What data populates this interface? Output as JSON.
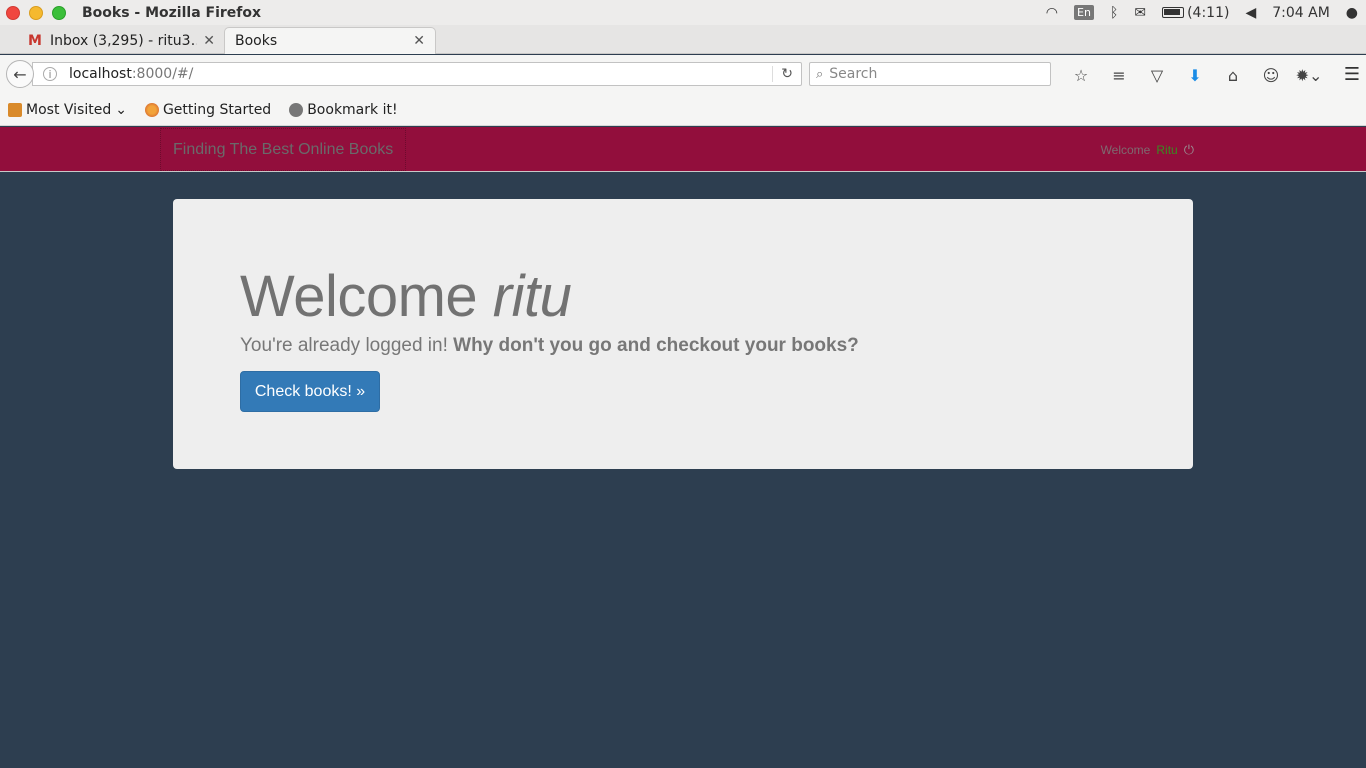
{
  "os": {
    "window_title": "Books - Mozilla Firefox",
    "keyboard_layout": "En",
    "battery": "(4:11)",
    "clock": "7:04 AM"
  },
  "tabs": [
    {
      "label": "Inbox (3,295) - ritu3…",
      "icon": "gmail-icon"
    },
    {
      "label": "Books",
      "icon": ""
    }
  ],
  "nav": {
    "url_host": "localhost",
    "url_rest": ":8000/#/",
    "search_placeholder": "Search"
  },
  "bookmarks": [
    {
      "label": "Most Visited",
      "icon": "folder-icon"
    },
    {
      "label": "Getting Started",
      "icon": "firefox-icon"
    },
    {
      "label": "Bookmark it!",
      "icon": "globe-icon"
    }
  ],
  "page": {
    "brand": "Finding The Best Online Books",
    "welcome_prefix": "Welcome",
    "welcome_user": "Ritu",
    "heading_prefix": "Welcome",
    "heading_user": "ritu",
    "message_plain": "You're already logged in!",
    "message_bold": "Why don't you go and checkout your books?",
    "cta_label": "Check books! »"
  },
  "colors": {
    "navbar_bg": "#920e3c",
    "page_bg": "#2d3e50",
    "jumbo_bg": "#eeeeee",
    "button_bg": "#337ab7"
  }
}
